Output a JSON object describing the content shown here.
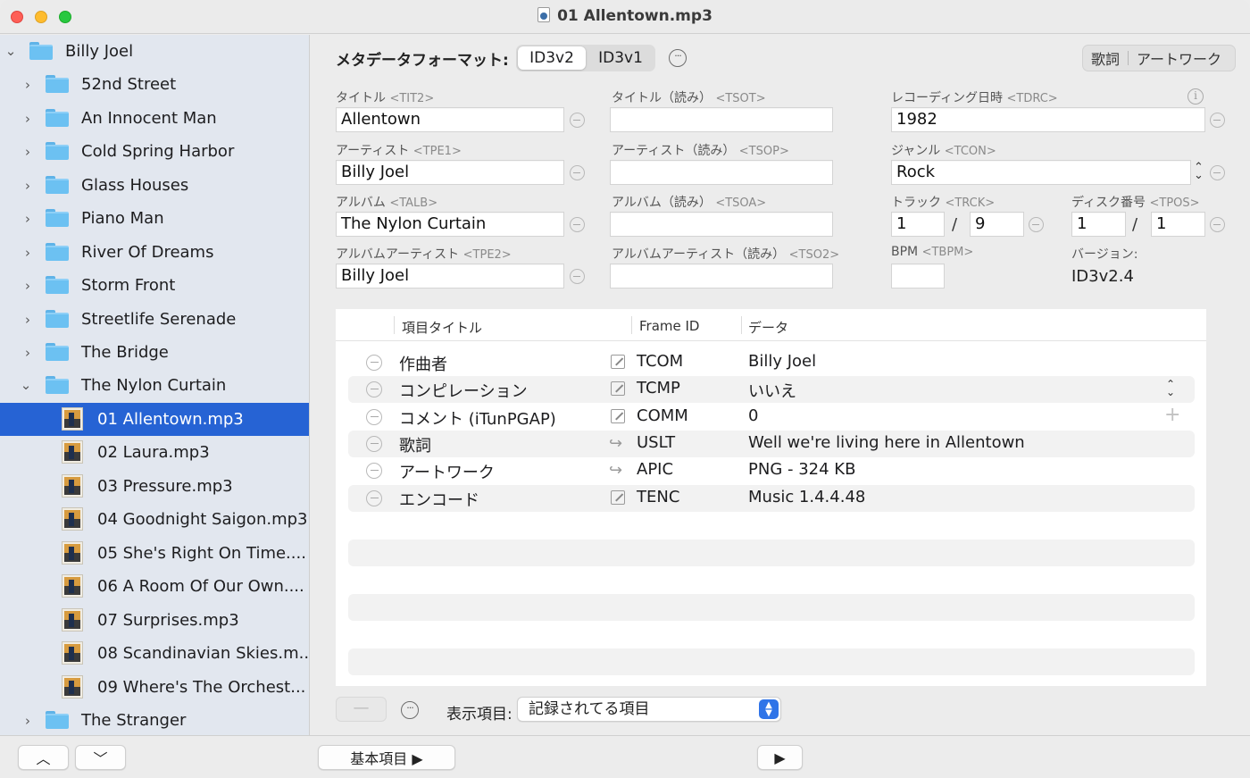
{
  "window": {
    "title": "01 Allentown.mp3"
  },
  "sidebar": {
    "root": {
      "label": "Billy Joel"
    },
    "folders_before": [
      {
        "label": "52nd Street"
      },
      {
        "label": "An Innocent Man"
      },
      {
        "label": "Cold Spring Harbor"
      },
      {
        "label": "Glass Houses"
      },
      {
        "label": "Piano Man"
      },
      {
        "label": "River Of Dreams"
      },
      {
        "label": "Storm Front"
      },
      {
        "label": "Streetlife Serenade"
      },
      {
        "label": "The Bridge"
      }
    ],
    "open_folder": {
      "label": "The Nylon Curtain"
    },
    "files": [
      {
        "label": "01 Allentown.mp3",
        "selected": true
      },
      {
        "label": "02 Laura.mp3"
      },
      {
        "label": "03 Pressure.mp3"
      },
      {
        "label": "04 Goodnight Saigon.mp3"
      },
      {
        "label": "05 She's Right On Time...."
      },
      {
        "label": "06 A Room Of Our Own...."
      },
      {
        "label": "07 Surprises.mp3"
      },
      {
        "label": "08 Scandinavian Skies.m..."
      },
      {
        "label": "09 Where's The Orchest..."
      }
    ],
    "folders_after": [
      {
        "label": "The Stranger"
      }
    ],
    "selection_color": "#2663d4"
  },
  "toolbar": {
    "format_label": "メタデータフォーマット:",
    "formats": [
      "ID3v2",
      "ID3v1"
    ],
    "selected_format": "ID3v2",
    "right_buttons": [
      "歌詞",
      "アートワーク"
    ]
  },
  "fields": {
    "title": {
      "label": "タイトル",
      "tag": "<TIT2>",
      "value": "Allentown"
    },
    "title_sort": {
      "label": "タイトル（読み）",
      "tag": "<TSOT>",
      "value": ""
    },
    "recording_date": {
      "label": "レコーディング日時",
      "tag": "<TDRC>",
      "value": "1982"
    },
    "artist": {
      "label": "アーティスト",
      "tag": "<TPE1>",
      "value": "Billy Joel"
    },
    "artist_sort": {
      "label": "アーティスト（読み）",
      "tag": "<TSOP>",
      "value": ""
    },
    "genre": {
      "label": "ジャンル",
      "tag": "<TCON>",
      "value": "Rock"
    },
    "album": {
      "label": "アルバム",
      "tag": "<TALB>",
      "value": "The Nylon Curtain"
    },
    "album_sort": {
      "label": "アルバム（読み）",
      "tag": "<TSOA>",
      "value": ""
    },
    "track": {
      "label": "トラック",
      "tag": "<TRCK>",
      "number": "1",
      "total": "9"
    },
    "disc": {
      "label": "ディスク番号",
      "tag": "<TPOS>",
      "number": "1",
      "total": "1"
    },
    "album_artist": {
      "label": "アルバムアーティスト",
      "tag": "<TPE2>",
      "value": "Billy Joel"
    },
    "album_artist_sort": {
      "label": "アルバムアーティスト（読み）",
      "tag": "<TSO2>",
      "value": ""
    },
    "bpm": {
      "label": "BPM",
      "tag": "<TBPM>",
      "value": ""
    },
    "version": {
      "label": "バージョン:",
      "value": "ID3v2.4"
    },
    "slash": "/"
  },
  "table": {
    "headers": [
      "項目タイトル",
      "Frame ID",
      "データ"
    ],
    "rows": [
      {
        "title": "作曲者",
        "frame_id": "TCOM",
        "data": "Billy Joel",
        "icon": "edit-icon"
      },
      {
        "title": "コンピレーション",
        "frame_id": "TCMP",
        "data": "いいえ",
        "icon": "edit-icon"
      },
      {
        "title": "コメント (iTunPGAP)",
        "frame_id": "COMM",
        "data": "0",
        "icon": "edit-icon"
      },
      {
        "title": "歌詞",
        "frame_id": "USLT",
        "data": "Well we're living here in Allentown",
        "icon": "share-icon"
      },
      {
        "title": "アートワーク",
        "frame_id": "APIC",
        "data": "PNG - 324 KB",
        "icon": "share-icon"
      },
      {
        "title": "エンコード",
        "frame_id": "TENC",
        "data": "Music 1.4.4.48",
        "icon": "edit-icon"
      }
    ]
  },
  "footer": {
    "minus_label": "—",
    "display_label": "表示項目:",
    "display_value": "記録されてる項目",
    "basic_button": "基本項目 ▶",
    "up_label": "︿",
    "down_label": "﹀",
    "play_label": "▶"
  }
}
